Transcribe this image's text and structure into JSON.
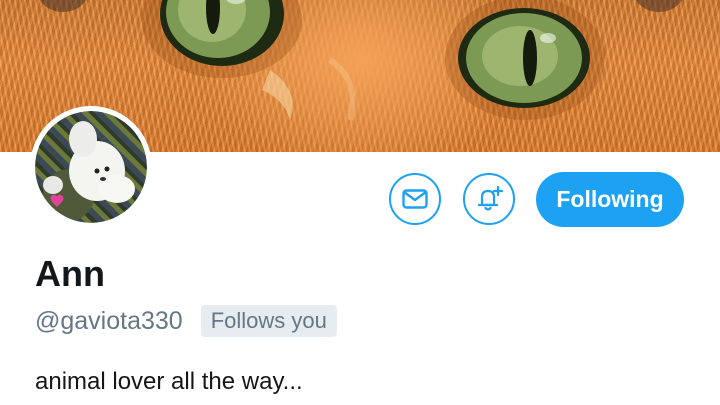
{
  "banner": {
    "image": "orange-cat-eyes-photo"
  },
  "avatar": {
    "image": "white-dog-avatar"
  },
  "actions": {
    "message_icon": "envelope-icon",
    "notify_icon": "bell-plus-icon",
    "follow_label": "Following"
  },
  "profile": {
    "name": "Ann",
    "handle": "@gaviota330",
    "follows_you": "Follows you",
    "bio": "animal lover all the way..."
  },
  "colors": {
    "accent": "#1da1f2",
    "text_primary": "#14171a",
    "text_secondary": "#657786",
    "badge_bg": "#e6ecf0"
  }
}
